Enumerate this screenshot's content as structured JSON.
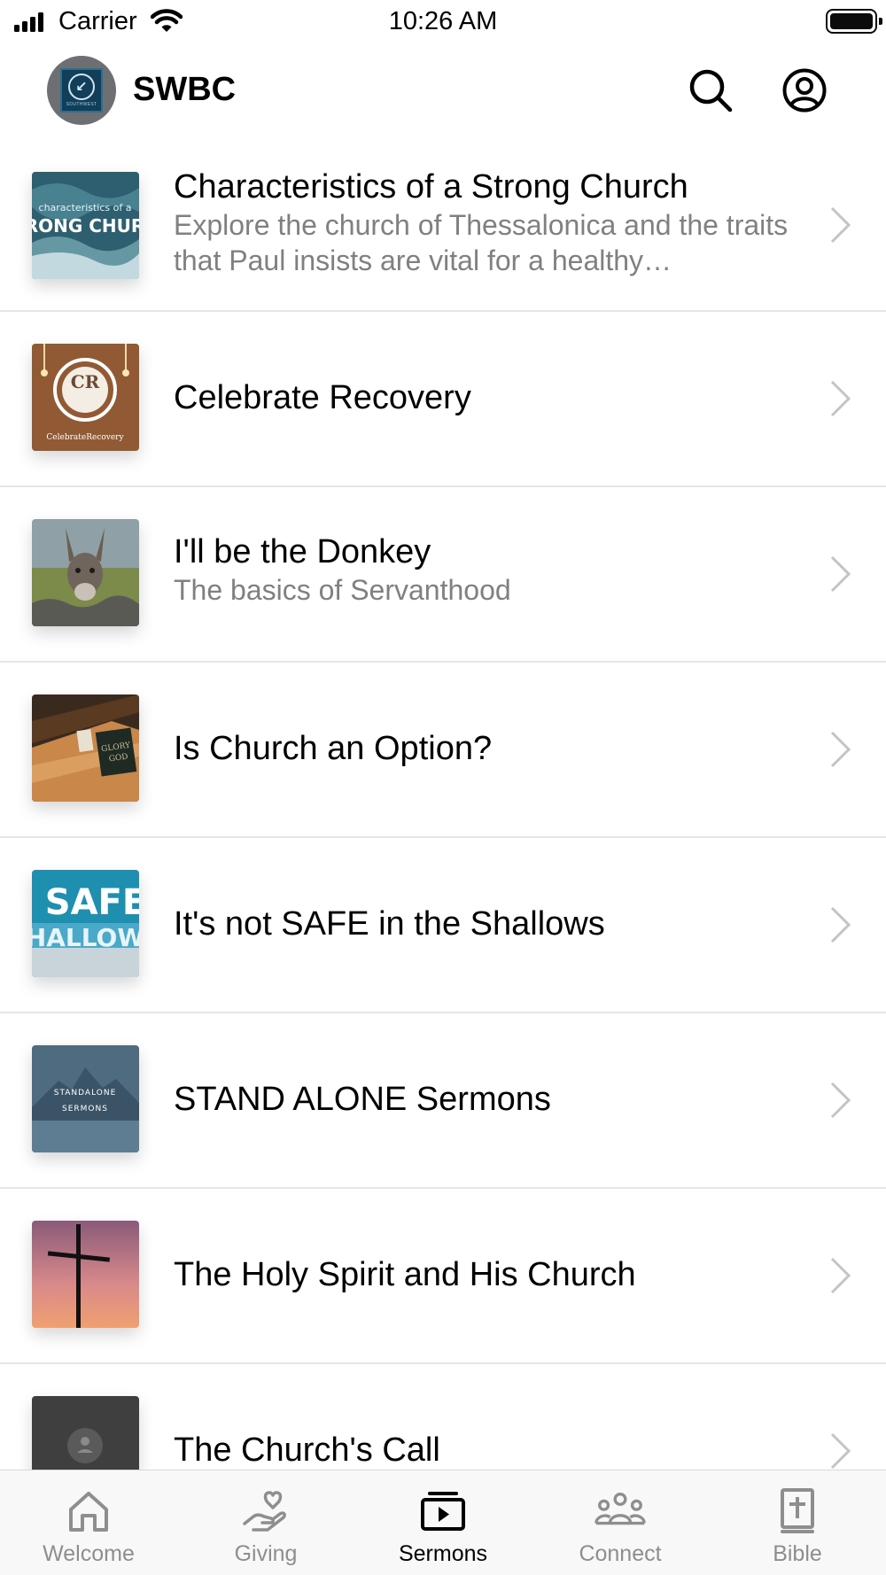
{
  "status_bar": {
    "carrier": "Carrier",
    "time": "10:26 AM"
  },
  "header": {
    "title": "SWBC",
    "logo_text": "SOUTHWEST",
    "search_icon": "search-icon",
    "profile_icon": "user-circle-icon"
  },
  "sermons": [
    {
      "title": "Characteristics of a Strong Church",
      "subtitle": "Explore the church of Thessalonica and the traits that Paul insists are vital for a healthy…",
      "thumb_line1": "characteristics of a",
      "thumb_line2": "TRONG CHURC"
    },
    {
      "title": "Celebrate Recovery",
      "subtitle": "",
      "thumb_line1": "CR",
      "thumb_line2": "CelebrateRecovery"
    },
    {
      "title": "I'll be the Donkey",
      "subtitle": "The basics of Servanthood"
    },
    {
      "title": "Is Church an Option?",
      "subtitle": "",
      "thumb_line1": "GLORY",
      "thumb_line2": "GOD"
    },
    {
      "title": "It's not SAFE in the Shallows",
      "subtitle": "",
      "thumb_line1": "SAFE",
      "thumb_line2": "HALLOW"
    },
    {
      "title": "STAND ALONE Sermons",
      "subtitle": "",
      "thumb_line1": "STANDALONE",
      "thumb_line2": "SERMONS"
    },
    {
      "title": "The Holy Spirit and His Church",
      "subtitle": ""
    },
    {
      "title": "The Church's Call",
      "subtitle": ""
    }
  ],
  "tabs": [
    {
      "label": "Welcome",
      "icon": "home-icon",
      "active": false
    },
    {
      "label": "Giving",
      "icon": "giving-hand-heart-icon",
      "active": false
    },
    {
      "label": "Sermons",
      "icon": "video-play-icon",
      "active": true
    },
    {
      "label": "Connect",
      "icon": "people-group-icon",
      "active": false
    },
    {
      "label": "Bible",
      "icon": "bible-cross-icon",
      "active": false
    }
  ],
  "colors": {
    "active_tab": "#000000",
    "inactive_tab": "#8e8e8e",
    "subtitle": "#808080",
    "divider": "#e6e6e6"
  }
}
